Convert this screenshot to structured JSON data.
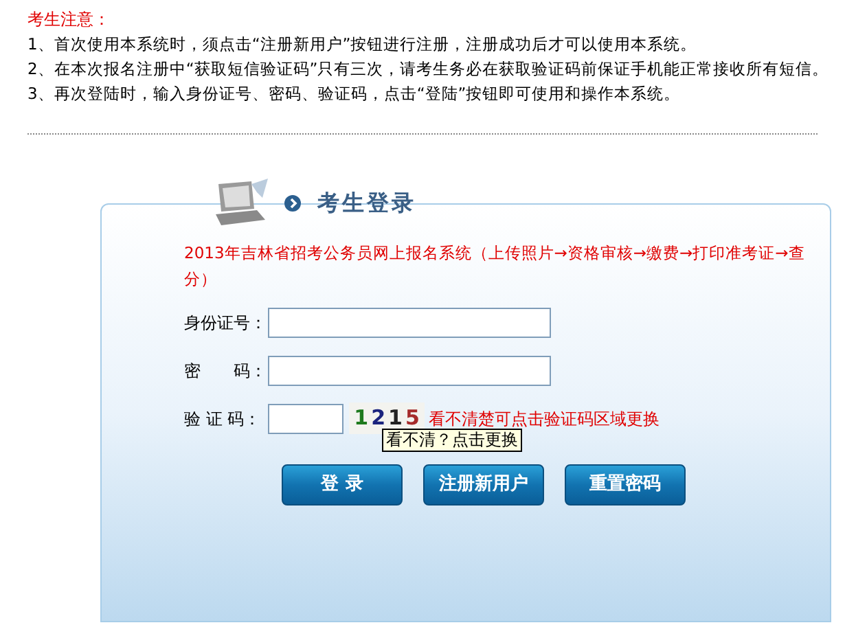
{
  "notice": {
    "title": "考生注意：",
    "items": [
      "1、首次使用本系统时，须点击“注册新用户”按钮进行注册，注册成功后才可以使用本系统。",
      "2、在本次报名注册中“获取短信验证码”只有三次，请考生务必在获取验证码前保证手机能正常接收所有短信。",
      "3、再次登陆时，输入身份证号、密码、验证码，点击“登陆”按钮即可使用和操作本系统。"
    ]
  },
  "login": {
    "title": "考生登录",
    "system_text": "2013年吉林省招考公务员网上报名系统（上传照片→资格审核→缴费→打印准考证→查分）",
    "fields": [
      {
        "label": "身份证号：",
        "kind": "id"
      },
      {
        "label": "密　　码：",
        "kind": "password"
      },
      {
        "label": "验 证 码：",
        "kind": "captcha"
      }
    ],
    "captcha": [
      {
        "digit": "1",
        "color": "#1e7a1e"
      },
      {
        "digit": "2",
        "color": "#1a237e"
      },
      {
        "digit": "1",
        "color": "#222222"
      },
      {
        "digit": "5",
        "color": "#a52a2a"
      }
    ],
    "captcha_hint": "看不清楚可点击验证码区域更换",
    "tooltip": "看不清？点击更换",
    "buttons": [
      "登 录",
      "注册新用户",
      "重置密码"
    ]
  }
}
